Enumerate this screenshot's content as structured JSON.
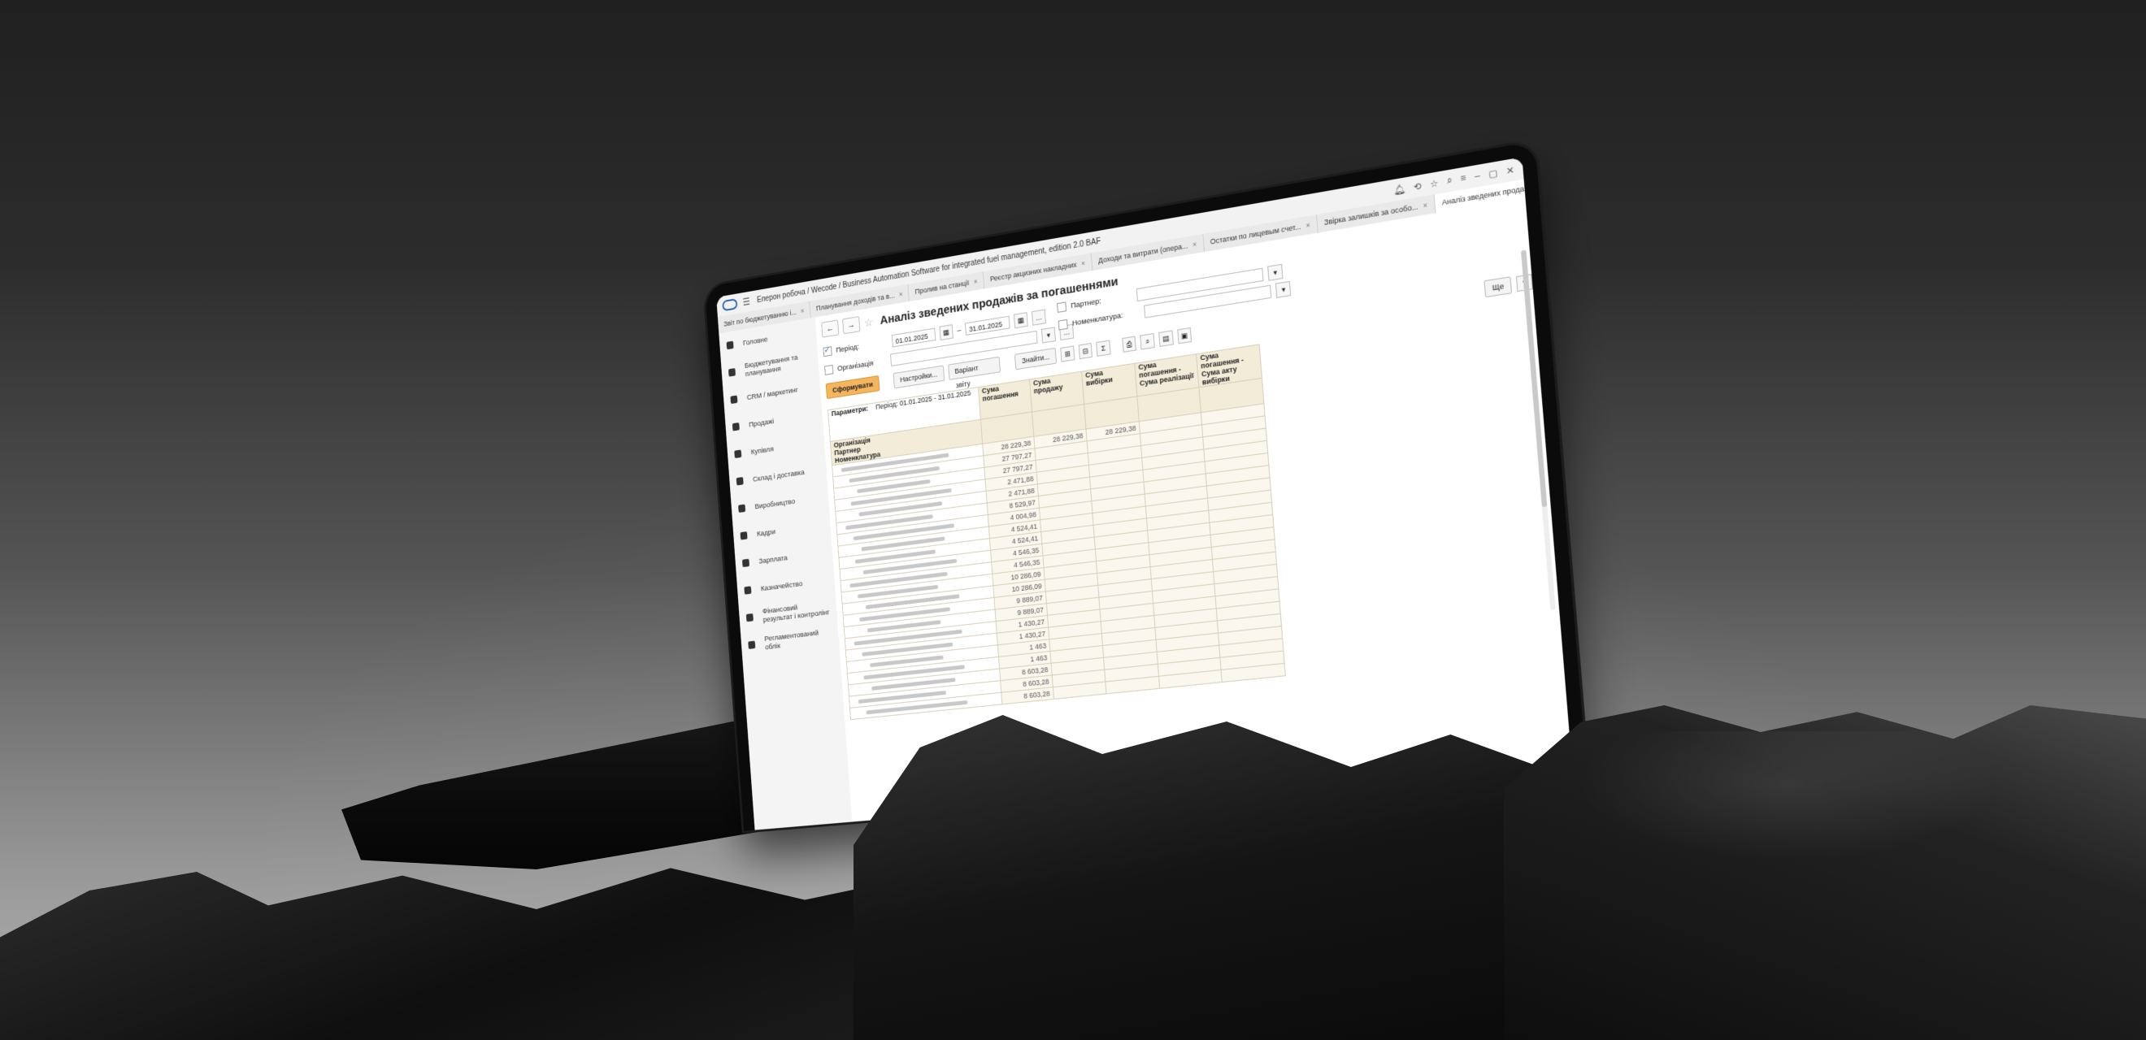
{
  "window": {
    "title": "Еперон робоча / Wecode / Business Automation Software for integrated fuel management, edition 2.0 BAF"
  },
  "tabs": [
    {
      "label": "Звіт по бюджетуванню і...",
      "active": false
    },
    {
      "label": "Планування доходів та в...",
      "active": false
    },
    {
      "label": "Пролив на станції",
      "active": false
    },
    {
      "label": "Реєстр акцизних накладних",
      "active": false
    },
    {
      "label": "Доходи та витрати (опера...",
      "active": false
    },
    {
      "label": "Остатки по лицевым счет...",
      "active": false
    },
    {
      "label": "Звірка залишків за особо...",
      "active": false
    },
    {
      "label": "Аналіз зведених продажі...",
      "active": true
    }
  ],
  "sidebar": {
    "items": [
      {
        "label": "Головне",
        "icon": "list-icon"
      },
      {
        "label": "Бюджетування та планування",
        "icon": "chart-icon"
      },
      {
        "label": "CRM / маркетинг",
        "icon": "pie-icon"
      },
      {
        "label": "Продажі",
        "icon": "bag-icon"
      },
      {
        "label": "Купівля",
        "icon": "cart-icon"
      },
      {
        "label": "Склад і доставка",
        "icon": "grid-icon"
      },
      {
        "label": "Виробництво",
        "icon": "factory-icon"
      },
      {
        "label": "Кадри",
        "icon": "person-icon"
      },
      {
        "label": "Зарплата",
        "icon": "wallet-icon"
      },
      {
        "label": "Казначейство",
        "icon": "coin-icon"
      },
      {
        "label": "Фінансовий результат і контролінг",
        "icon": "finance-icon"
      },
      {
        "label": "Регламентований облік",
        "icon": "doc-icon"
      }
    ]
  },
  "report": {
    "title": "Аналіз зведених продажів за погашеннями",
    "period_label": "Період:",
    "date_from": "01.01.2025",
    "date_to": "31.01.2025",
    "organization_label": "Організація",
    "partner_label": "Партнер:",
    "nomenclature_label": "Номенклатура:",
    "generate_button": "Сформувати",
    "settings_button": "Настройки...",
    "variant_button": "Варіант звіту",
    "find_button": "Знайти...",
    "more_button": "Ще",
    "help_button": "?",
    "params_label": "Параметри:",
    "params_value": "Період: 01.01.2025 - 31.01.2025",
    "row_group_headers": [
      "Організація",
      "Партнер",
      "Номенклатура"
    ],
    "columns": [
      "Сума погашення",
      "Сума продажу",
      "Сума вибірки",
      "Сума погашення - Сума реалізації",
      "Сума погашення - Сума акту вибірки"
    ],
    "rows": [
      {
        "level": 0,
        "sum_repay": "28 229,38",
        "sum_sales": "28 229,38",
        "sum_select": "28 229,38"
      },
      {
        "level": 1,
        "sum_repay": "27 797,27",
        "sum_sales": "",
        "sum_select": ""
      },
      {
        "level": 2,
        "sum_repay": "27 797,27",
        "sum_sales": "",
        "sum_select": ""
      },
      {
        "level": 1,
        "sum_repay": "2 471,88",
        "sum_sales": "",
        "sum_select": ""
      },
      {
        "level": 2,
        "sum_repay": "2 471,88",
        "sum_sales": "",
        "sum_select": ""
      },
      {
        "level": 0,
        "sum_repay": "8 529,97",
        "sum_sales": "",
        "sum_select": ""
      },
      {
        "level": 1,
        "sum_repay": "4 004,98",
        "sum_sales": "",
        "sum_select": ""
      },
      {
        "level": 2,
        "sum_repay": "4 524,41",
        "sum_sales": "",
        "sum_select": ""
      },
      {
        "level": 1,
        "sum_repay": "4 524,41",
        "sum_sales": "",
        "sum_select": ""
      },
      {
        "level": 2,
        "sum_repay": "4 546,35",
        "sum_sales": "",
        "sum_select": ""
      },
      {
        "level": 0,
        "sum_repay": "4 546,35",
        "sum_sales": "",
        "sum_select": ""
      },
      {
        "level": 1,
        "sum_repay": "10 286,09",
        "sum_sales": "",
        "sum_select": ""
      },
      {
        "level": 2,
        "sum_repay": "10 286,09",
        "sum_sales": "",
        "sum_select": ""
      },
      {
        "level": 1,
        "sum_repay": "9 889,07",
        "sum_sales": "",
        "sum_select": ""
      },
      {
        "level": 2,
        "sum_repay": "9 889,07",
        "sum_sales": "",
        "sum_select": ""
      },
      {
        "level": 0,
        "sum_repay": "1 430,27",
        "sum_sales": "",
        "sum_select": ""
      },
      {
        "level": 1,
        "sum_repay": "1 430,27",
        "sum_sales": "",
        "sum_select": ""
      },
      {
        "level": 2,
        "sum_repay": "1 463",
        "sum_sales": "",
        "sum_select": ""
      },
      {
        "level": 1,
        "sum_repay": "1 463",
        "sum_sales": "",
        "sum_select": ""
      },
      {
        "level": 2,
        "sum_repay": "8 603,28",
        "sum_sales": "",
        "sum_select": ""
      },
      {
        "level": 0,
        "sum_repay": "8 603,28",
        "sum_sales": "",
        "sum_select": ""
      },
      {
        "level": 1,
        "sum_repay": "8 603,28",
        "sum_sales": "",
        "sum_select": ""
      }
    ]
  },
  "colors": {
    "accent": "#3b7ad6",
    "primary_button": "#f4b55f",
    "table_header": "#f3ecd8"
  }
}
